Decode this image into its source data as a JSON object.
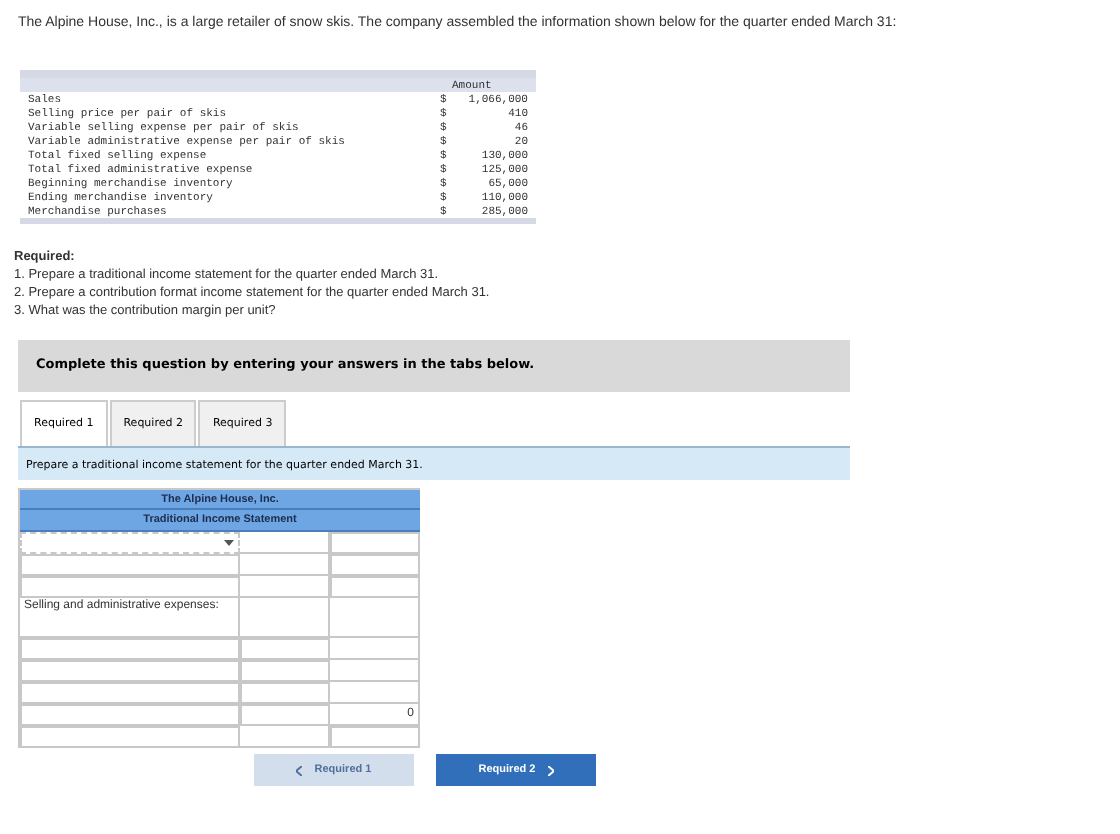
{
  "intro": "The Alpine House, Inc., is a large retailer of snow skis. The company assembled the information shown below for the quarter ended March 31:",
  "data_table": {
    "column_header": "Amount",
    "rows": [
      {
        "label": "Sales",
        "symbol": "$",
        "value": "1,066,000"
      },
      {
        "label": "Selling price per pair of skis",
        "symbol": "$",
        "value": "410"
      },
      {
        "label": "Variable selling expense per pair of skis",
        "symbol": "$",
        "value": "46"
      },
      {
        "label": "Variable administrative expense per pair of skis",
        "symbol": "$",
        "value": "20"
      },
      {
        "label": "Total fixed selling expense",
        "symbol": "$",
        "value": "130,000"
      },
      {
        "label": "Total fixed administrative expense",
        "symbol": "$",
        "value": "125,000"
      },
      {
        "label": "Beginning merchandise inventory",
        "symbol": "$",
        "value": "65,000"
      },
      {
        "label": "Ending merchandise inventory",
        "symbol": "$",
        "value": "110,000"
      },
      {
        "label": "Merchandise purchases",
        "symbol": "$",
        "value": "285,000"
      }
    ]
  },
  "required_heading": "Required:",
  "required_items": [
    "1. Prepare a traditional income statement for the quarter ended March 31.",
    "2. Prepare a contribution format income statement for the quarter ended March 31.",
    "3. What was the contribution margin per unit?"
  ],
  "instruction_box": "Complete this question by entering your answers in the tabs below.",
  "tabs": [
    {
      "label": "Required 1",
      "selected": true
    },
    {
      "label": "Required 2",
      "selected": false
    },
    {
      "label": "Required 3",
      "selected": false
    }
  ],
  "tab_prompt": "Prepare a traditional income statement for the quarter ended March 31.",
  "worksheet": {
    "title": "The Alpine House, Inc.",
    "subtitle": "Traditional Income Statement",
    "rows": [
      {
        "cells": [
          {
            "kind": "dropdown"
          },
          {
            "kind": "blank"
          },
          {
            "kind": "input"
          }
        ]
      },
      {
        "cells": [
          {
            "kind": "input"
          },
          {
            "kind": "blank"
          },
          {
            "kind": "input"
          }
        ]
      },
      {
        "cells": [
          {
            "kind": "input"
          },
          {
            "kind": "blank"
          },
          {
            "kind": "input"
          }
        ]
      },
      {
        "cells": [
          {
            "kind": "text",
            "text": "Selling and administrative expenses:"
          },
          {
            "kind": "blank"
          },
          {
            "kind": "blank"
          }
        ]
      },
      {
        "cells": [
          {
            "kind": "input"
          },
          {
            "kind": "input"
          },
          {
            "kind": "blank"
          }
        ]
      },
      {
        "cells": [
          {
            "kind": "input"
          },
          {
            "kind": "input"
          },
          {
            "kind": "blank"
          }
        ]
      },
      {
        "cells": [
          {
            "kind": "input"
          },
          {
            "kind": "input"
          },
          {
            "kind": "blank"
          }
        ]
      },
      {
        "cells": [
          {
            "kind": "input"
          },
          {
            "kind": "input"
          },
          {
            "kind": "text",
            "text": "0"
          }
        ]
      },
      {
        "cells": [
          {
            "kind": "input"
          },
          {
            "kind": "blank"
          },
          {
            "kind": "input"
          }
        ]
      }
    ]
  },
  "nav_buttons": [
    {
      "label": "Required 1",
      "kind": "previous",
      "disabled": true
    },
    {
      "label": "Required 2",
      "kind": "next",
      "disabled": false
    }
  ]
}
